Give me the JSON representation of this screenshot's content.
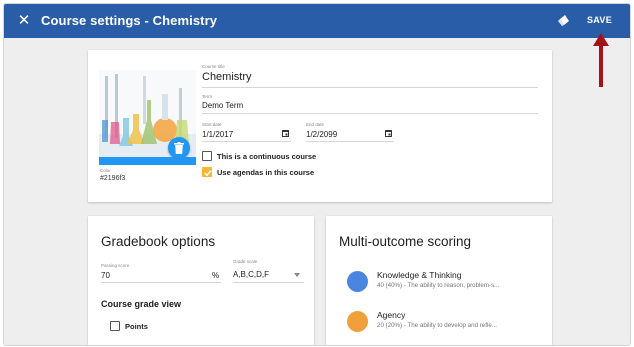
{
  "header": {
    "title": "Course settings - Chemistry",
    "save_label": "SAVE",
    "close_icon": "close-icon",
    "tool_icon": "paint-bucket-icon",
    "bar_color": "#2a5da8"
  },
  "course": {
    "title_label": "Course title",
    "title_value": "Chemistry",
    "term_label": "Term",
    "term_value": "Demo Term",
    "start_label": "Start date",
    "start_value": "1/1/2017",
    "end_label": "End date",
    "end_value": "1/2/2099",
    "color_label": "Color",
    "color_value": "#2196f3",
    "continuous_label": "This is a continuous course",
    "continuous_checked": false,
    "agendas_label": "Use agendas in this course",
    "agendas_checked": true
  },
  "gradebook": {
    "heading": "Gradebook options",
    "passing_label": "Passing score",
    "passing_value": "70",
    "passing_unit": "%",
    "scale_label": "Grade scale",
    "scale_value": "A,B,C,D,F",
    "course_grade_view": "Course grade view",
    "points_label": "Points",
    "points_checked": false
  },
  "multi_outcome": {
    "heading": "Multi-outcome scoring",
    "items": [
      {
        "name": "Knowledge & Thinking",
        "desc": "40 (40%) - The ability to reason, problem-s...",
        "color": "#4a86e0"
      },
      {
        "name": "Agency",
        "desc": "20 (20%) - The ability to develop and refle...",
        "color": "#f0a03a"
      }
    ]
  }
}
